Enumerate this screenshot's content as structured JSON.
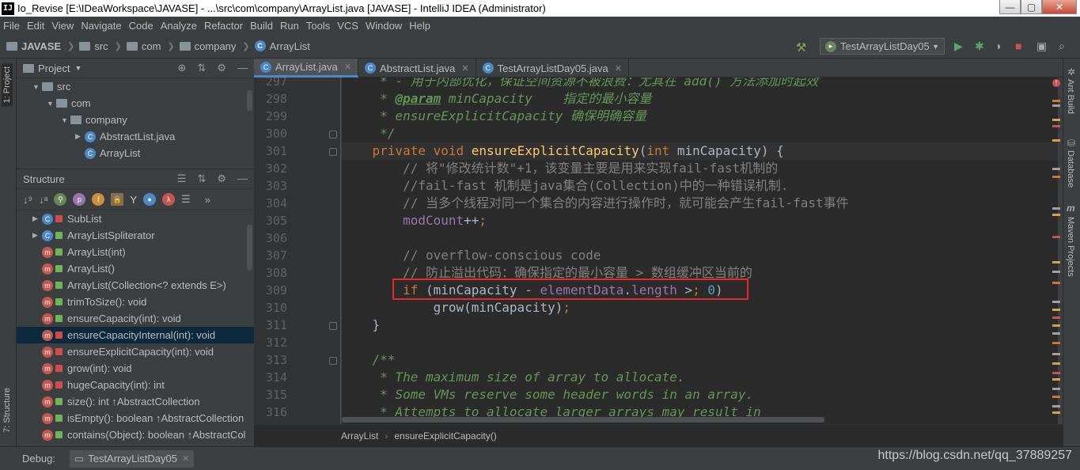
{
  "window": {
    "app_icon": "IJ",
    "title": "Io_Revise [E:\\IDeaWorkspace\\JAVASE] - ...\\src\\com\\company\\ArrayList.java [JAVASE] - IntelliJ IDEA (Administrator)",
    "min_btn": "—",
    "max_btn": "▢",
    "close_btn": "✕"
  },
  "menu": [
    "File",
    "Edit",
    "View",
    "Navigate",
    "Code",
    "Analyze",
    "Refactor",
    "Build",
    "Run",
    "Tools",
    "VCS",
    "Window",
    "Help"
  ],
  "navbar": {
    "crumbs": [
      "JAVASE",
      "src",
      "com",
      "company",
      "ArrayList"
    ],
    "run_config": "TestArrayListDay05"
  },
  "left_strip": {
    "project_tab": "1: Project",
    "structure_tab": "7: Structure"
  },
  "project_panel": {
    "title": "Project",
    "tree": [
      {
        "label": "src",
        "kind": "folder",
        "indent": 0,
        "arrow": "▼"
      },
      {
        "label": "com",
        "kind": "folder",
        "indent": 1,
        "arrow": "▼"
      },
      {
        "label": "company",
        "kind": "folder",
        "indent": 2,
        "arrow": "▼"
      },
      {
        "label": "AbstractList.java",
        "kind": "class",
        "indent": 3,
        "arrow": "▶"
      },
      {
        "label": "ArrayList",
        "kind": "class",
        "indent": 3,
        "arrow": ""
      }
    ]
  },
  "structure_panel": {
    "title": "Structure",
    "items": [
      {
        "label": "SubList",
        "icon": "class",
        "vis": "priv",
        "arrow": "▶",
        "selected": false
      },
      {
        "label": "ArrayListSpliterator",
        "icon": "class",
        "vis": "pub",
        "arrow": "▶",
        "selected": false
      },
      {
        "label": "ArrayList(int)",
        "icon": "method",
        "vis": "pub",
        "arrow": "",
        "selected": false
      },
      {
        "label": "ArrayList()",
        "icon": "method",
        "vis": "pub",
        "arrow": "",
        "selected": false
      },
      {
        "label": "ArrayList(Collection<? extends E>)",
        "icon": "method",
        "vis": "pub",
        "arrow": "",
        "selected": false
      },
      {
        "label": "trimToSize(): void",
        "icon": "method",
        "vis": "pub",
        "arrow": "",
        "selected": false
      },
      {
        "label": "ensureCapacity(int): void",
        "icon": "method",
        "vis": "pub",
        "arrow": "",
        "selected": false
      },
      {
        "label": "ensureCapacityInternal(int): void",
        "icon": "method",
        "vis": "priv",
        "arrow": "",
        "selected": true
      },
      {
        "label": "ensureExplicitCapacity(int): void",
        "icon": "method",
        "vis": "priv",
        "arrow": "",
        "selected": false
      },
      {
        "label": "grow(int): void",
        "icon": "method",
        "vis": "priv",
        "arrow": "",
        "selected": false
      },
      {
        "label": "hugeCapacity(int): int",
        "icon": "method",
        "vis": "priv",
        "arrow": "",
        "selected": false
      },
      {
        "label": "size(): int ↑AbstractCollection",
        "icon": "method",
        "vis": "pub",
        "arrow": "",
        "selected": false
      },
      {
        "label": "isEmpty(): boolean ↑AbstractCollection",
        "icon": "method",
        "vis": "pub",
        "arrow": "",
        "selected": false
      },
      {
        "label": "contains(Object): boolean ↑AbstractCol",
        "icon": "method",
        "vis": "pub",
        "arrow": "",
        "selected": false
      }
    ]
  },
  "editor": {
    "tabs": [
      {
        "label": "ArrayList.java",
        "active": true
      },
      {
        "label": "AbstractList.java",
        "active": false
      },
      {
        "label": "TestArrayListDay05.java",
        "active": false
      }
    ],
    "first_line": 297,
    "lines": [
      "     * - 用于内部优化，保证空间资源不被浪费：尤其在 add() 方法添加时起效",
      "     * @param minCapacity    指定的最小容量",
      "     * ensureExplicitCapacity 确保明确容量",
      "     */",
      "    private void ensureExplicitCapacity(int minCapacity) {",
      "        // 将\"修改统计数\"+1，该变量主要是用来实现fail-fast机制的",
      "        //fail-fast 机制是java集合(Collection)中的一种错误机制.",
      "        // 当多个线程对同一个集合的内容进行操作时，就可能会产生fail-fast事件",
      "        modCount++;",
      "",
      "        // overflow-conscious code",
      "        // 防止溢出代码：确保指定的最小容量 > 数组缓冲区当前的",
      "        if (minCapacity - elementData.length > 0)",
      "            grow(minCapacity);",
      "    }",
      "",
      "    /**",
      "     * The maximum size of array to allocate.",
      "     * Some VMs reserve some header words in an array.",
      "     * Attempts to allocate larger arrays may result in"
    ],
    "breadcrumb": [
      "ArrayList",
      "ensureExplicitCapacity()"
    ]
  },
  "right_strip": {
    "tabs": [
      "Ant Build",
      "Database",
      "Maven Projects"
    ]
  },
  "bottom": {
    "debug_label": "Debug:",
    "debug_tab": "TestArrayListDay05",
    "watermark": "https://blog.csdn.net/qq_37889257"
  },
  "colors": {
    "background": "#3c3f41",
    "editor_bg": "#2b2b2b",
    "keyword": "#cc7832",
    "function": "#ffc66d",
    "comment": "#808080",
    "doc_comment": "#629755",
    "field": "#9876aa",
    "number": "#6897bb",
    "highlight_box": "#e32a2a"
  }
}
